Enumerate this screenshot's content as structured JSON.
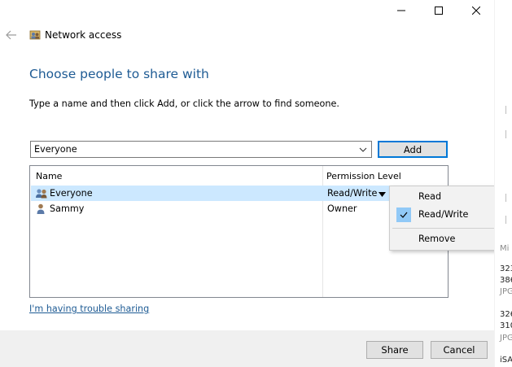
{
  "window": {
    "title": "Network access",
    "caption_buttons": [
      "minimize",
      "maximize",
      "close"
    ]
  },
  "colors": {
    "heading": "#1e5b94",
    "link": "#1e5b94",
    "selected_row": "#cce8ff",
    "menu_check_bg": "#91c9f7",
    "focus_border": "#0078d7",
    "footer_bg": "#f0f0f0"
  },
  "heading": "Choose people to share with",
  "instruction": "Type a name and then click Add, or click the arrow to find someone.",
  "user_select": {
    "value": "Everyone",
    "add_label": "Add"
  },
  "list": {
    "columns": [
      "Name",
      "Permission Level"
    ],
    "rows": [
      {
        "name": "Everyone",
        "permission": "Read/Write",
        "icon": "group-icon",
        "selected": true
      },
      {
        "name": "Sammy",
        "permission": "Owner",
        "icon": "user-icon",
        "selected": false
      }
    ]
  },
  "permission_menu": {
    "items": [
      {
        "label": "Read",
        "checked": false
      },
      {
        "label": "Read/Write",
        "checked": true
      },
      {
        "label": "Remove",
        "checked": false
      }
    ]
  },
  "trouble_link": "I'm having trouble sharing",
  "footer": {
    "share_label": "Share",
    "cancel_label": "Cancel"
  },
  "background_fragments": [
    "Mi",
    "323",
    "386",
    "JPG",
    "326",
    "310",
    "JPG",
    "iSA"
  ]
}
